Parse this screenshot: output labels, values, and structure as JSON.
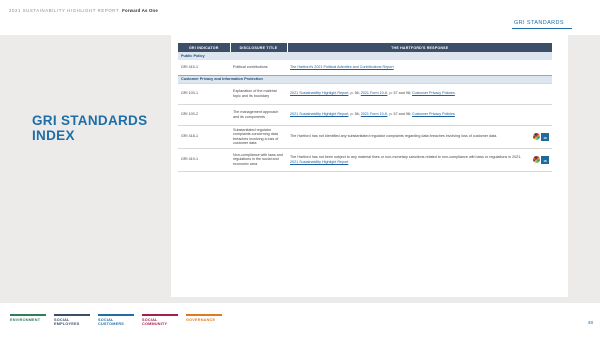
{
  "header": {
    "report_title": "2021 SUSTAINABILITY HIGHLIGHT REPORT",
    "subtitle": "Forward As One",
    "section_tag": "GRI STANDARDS"
  },
  "page_title_line1": "GRI STANDARDS",
  "page_title_line2": "INDEX",
  "table": {
    "columns": [
      "GRI INDICATOR",
      "DISCLOSURE TITLE",
      "THE HARTFORD'S RESPONSE"
    ],
    "groups": {
      "public_policy": "Public Policy",
      "customer_privacy": "Customer Privacy and Information Protection"
    },
    "rows": [
      {
        "indicator": "GRI 415-1",
        "title": "Political contributions",
        "response": "The Hartford's 2021 Political Activities and Contributions Report"
      },
      {
        "indicator": "GRI 103-1",
        "title": "Explanation of the material topic and its boundary",
        "response_link1": "2021 Sustainability Highlight Report",
        "response_mid": ", p. 56; ",
        "response_link2": "2021 Form 10-K",
        "response_mid2": ", p. 57 and 98; ",
        "response_link3": "Customer Privacy Policies"
      },
      {
        "indicator": "GRI 103-2",
        "title": "The management approach and its components",
        "response_link1": "2021 Sustainability Highlight Report",
        "response_mid": ", p. 56; ",
        "response_link2": "2021 Form 10-K",
        "response_mid2": ", p. 57 and 98; ",
        "response_link3": "Customer Privacy Policies"
      },
      {
        "indicator": "GRI 418-1",
        "title": "Substantiated regulator complaints concerning data breaches involving a loss of customer data",
        "response": "The Hartford has not identified any substantiated regulator complaints regarding data breaches involving loss of customer data.",
        "sdg": "16"
      },
      {
        "indicator": "GRI 419-1",
        "title": "Non-compliance with laws and regulations in the social and economic area",
        "response_plain": "The Hartford has not been subject to any material fines or non-monetary sanctions related to non-compliance with laws or regulations in 2021. ",
        "response_link": "2021 Sustainability Highlight Report",
        "sdg": "16"
      }
    ]
  },
  "footer": {
    "nav": [
      {
        "line1": "ENVIRONMENT",
        "line2": "",
        "color": "#2e7d5b"
      },
      {
        "line1": "SOCIAL",
        "line2": "EMPLOYEES",
        "color": "#3d4e68"
      },
      {
        "line1": "SOCIAL",
        "line2": "CUSTOMERS",
        "color": "#1e6fa8"
      },
      {
        "line1": "SOCIAL",
        "line2": "COMMUNITY",
        "color": "#a2224a"
      },
      {
        "line1": "GOVERNANCE",
        "line2": "",
        "color": "#e07a1f"
      }
    ],
    "page_number": "48"
  },
  "colors": {
    "accent": "#1e6fa8",
    "table_header": "#3d4e68",
    "group_row": "#dde6ef",
    "panel": "#ecebea"
  }
}
